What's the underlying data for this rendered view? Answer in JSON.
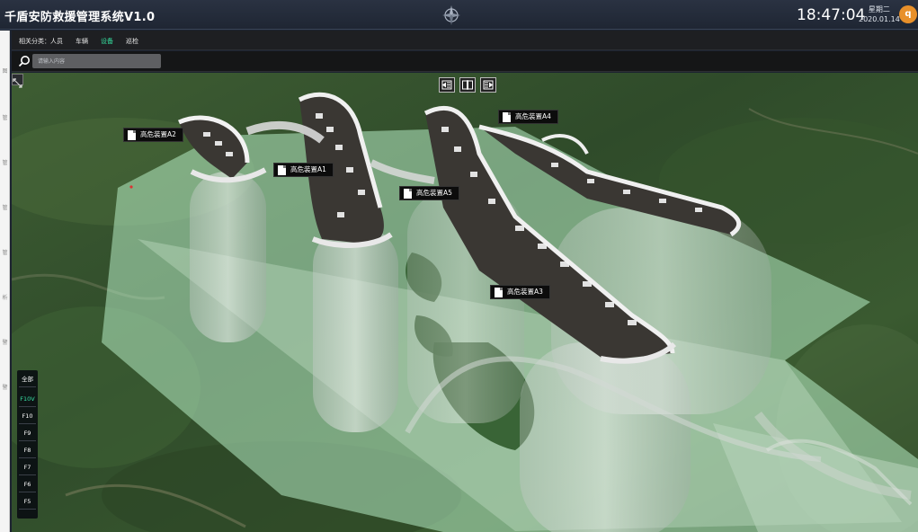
{
  "header": {
    "title": "千盾安防救援管理系统V1.0",
    "clock": "18:47:04",
    "weekday": "星期二",
    "date": "2020.01.14",
    "avatar_letter": "q"
  },
  "filter": {
    "label": "相关分类：",
    "items": [
      "人员",
      "车辆",
      "设备",
      "巡检"
    ],
    "active": "设备"
  },
  "search": {
    "placeholder": "请输入内容"
  },
  "left_rail": {
    "ticks": [
      "图",
      "管",
      "管",
      "管",
      "管",
      "析",
      "警",
      "警"
    ]
  },
  "devices": [
    {
      "label": "高危装置A2"
    },
    {
      "label": "高危装置A1"
    },
    {
      "label": "高危装置A5"
    },
    {
      "label": "高危装置A4"
    },
    {
      "label": "高危装置A3"
    }
  ],
  "floors": {
    "items": [
      "全部",
      "F10V",
      "F10",
      "F9",
      "F8",
      "F7",
      "F6",
      "F5"
    ],
    "active": "F10V"
  },
  "colors": {
    "accent": "#36e0a0",
    "avatar": "#e8902a",
    "header": "#1f2633"
  },
  "icons": [
    "compass-logo-icon",
    "search-icon",
    "expand-icon",
    "align-left-icon",
    "split-view-icon",
    "align-right-icon",
    "document-icon"
  ]
}
